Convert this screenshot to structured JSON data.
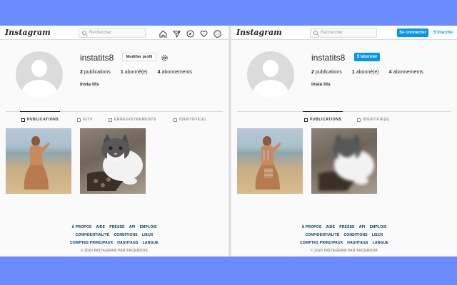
{
  "app": {
    "name": "Instagram"
  },
  "search": {
    "placeholder": "Rechercher"
  },
  "login": {
    "connect_label": "Se connecter",
    "signup_label": "S'inscrire"
  },
  "profile": {
    "username": "instatits8",
    "edit_label": "Modifier profil",
    "follow_label": "S'abonner",
    "stats": [
      {
        "count": "2",
        "label": "publications"
      },
      {
        "count": "1",
        "label": "abonné(e)"
      },
      {
        "count": "4",
        "label": "abonnements"
      }
    ],
    "bio": "insta tits"
  },
  "tabs_left": [
    "PUBLICATIONS",
    "IGTV",
    "ENREGISTREMENTS",
    "IDENTIFIÉ(E)"
  ],
  "tabs_right": [
    "PUBLICATIONS",
    "IDENTIFIÉ(E)"
  ],
  "footer": {
    "row1": [
      "À PROPOS",
      "AIDE",
      "PRESSE",
      "API",
      "EMPLOIS"
    ],
    "row2": [
      "CONFIDENTIALITÉ",
      "CONDITIONS",
      "LIEUX"
    ],
    "row3": [
      "COMPTES PRINCIPAUX",
      "HASHTAGS",
      "LANGUE"
    ],
    "copyright": "© 2020 INSTAGRAM PAR FACEBOOK"
  },
  "icons": [
    "search-icon",
    "home-icon",
    "direct-icon",
    "explore-icon",
    "heart-icon",
    "profile-icon",
    "gear-icon",
    "grid-icon",
    "igtv-icon",
    "bookmark-icon",
    "tag-icon"
  ],
  "colors": {
    "accent": "#0095f6",
    "background": "#fafafa",
    "outer": "#6b8cff"
  }
}
